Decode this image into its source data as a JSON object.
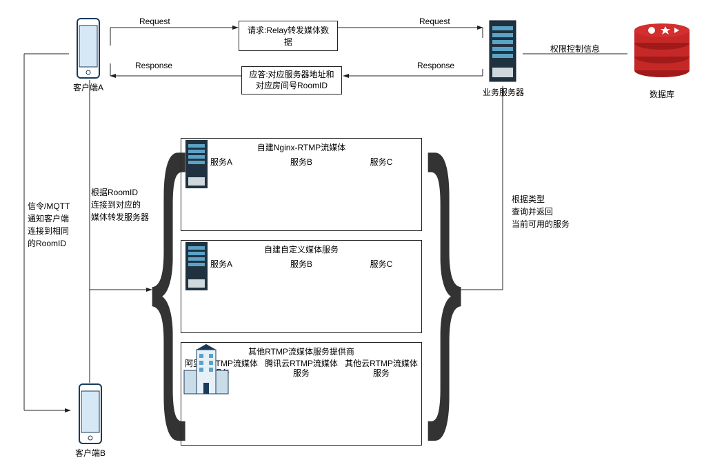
{
  "clientA": {
    "label": "客户端A"
  },
  "clientB": {
    "label": "客户端B"
  },
  "bizServer": {
    "label": "业务服务器"
  },
  "database": {
    "label": "数据库"
  },
  "reqBox": {
    "text": "请求:Relay转发媒体数据"
  },
  "resBox": {
    "text": "应答:对应服务器地址和对应房间号RoomID"
  },
  "reqLabelL": "Request",
  "resLabelL": "Response",
  "reqLabelR": "Request",
  "resLabelR": "Response",
  "permLink": "权限控制信息",
  "mqttNote": "信令/MQTT\n通知客户端\n连接到相同\n的RoomID",
  "roomIdNote": "根据RoomID\n连接到对应的\n媒体转发服务器",
  "queryNote": "根据类型\n查询并返回\n当前可用的服务",
  "cluster1": {
    "title": "自建Nginx-RTMP流媒体",
    "a": "服务A",
    "b": "服务B",
    "c": "服务C"
  },
  "cluster2": {
    "title": "自建自定义媒体服务",
    "a": "服务A",
    "b": "服务B",
    "c": "服务C"
  },
  "cluster3": {
    "title": "其他RTMP流媒体服务提供商",
    "a": "阿里云RTMP流媒体服务",
    "b": "腾讯云RTMP流媒体服务",
    "c": "其他云RTMP流媒体服务"
  }
}
